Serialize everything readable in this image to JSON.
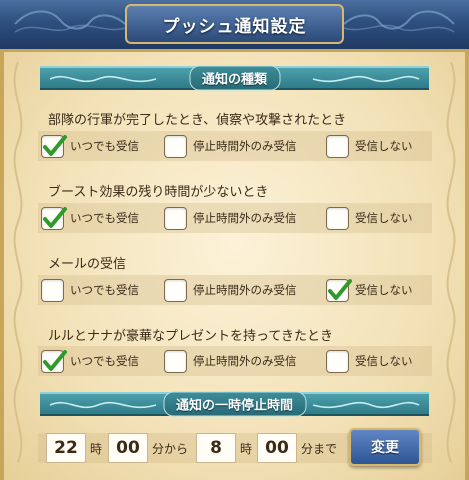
{
  "title": "プッシュ通知設定",
  "sections": {
    "types_header": "通知の種類",
    "pause_header": "通知の一時停止時間"
  },
  "groups": [
    {
      "title": "部隊の行軍が完了したとき、偵察や攻撃されたとき",
      "options": [
        {
          "label": "いつでも受信",
          "checked": true
        },
        {
          "label": "停止時間外のみ受信",
          "checked": false
        },
        {
          "label": "受信しない",
          "checked": false
        }
      ]
    },
    {
      "title": "ブースト効果の残り時間が少ないとき",
      "options": [
        {
          "label": "いつでも受信",
          "checked": true
        },
        {
          "label": "停止時間外のみ受信",
          "checked": false
        },
        {
          "label": "受信しない",
          "checked": false
        }
      ]
    },
    {
      "title": "メールの受信",
      "options": [
        {
          "label": "いつでも受信",
          "checked": false
        },
        {
          "label": "停止時間外のみ受信",
          "checked": false
        },
        {
          "label": "受信しない",
          "checked": true
        }
      ]
    },
    {
      "title": "ルルとナナが豪華なプレゼントを持ってきたとき",
      "options": [
        {
          "label": "いつでも受信",
          "checked": true
        },
        {
          "label": "停止時間外のみ受信",
          "checked": false
        },
        {
          "label": "受信しない",
          "checked": false
        }
      ]
    }
  ],
  "pause": {
    "start_hour": "22",
    "hour_unit": "時",
    "start_min": "00",
    "from_unit": "分から",
    "end_hour": "8",
    "end_min": "00",
    "to_unit": "分まで",
    "button": "変更"
  },
  "colors": {
    "check": "#2f9a2a",
    "title_blue": "#2e4f7e",
    "header_teal": "#3a8f9b",
    "button_blue": "#3b63a3"
  },
  "icons": {
    "checkmark": "check-icon",
    "ornament": "ornament-icon"
  }
}
